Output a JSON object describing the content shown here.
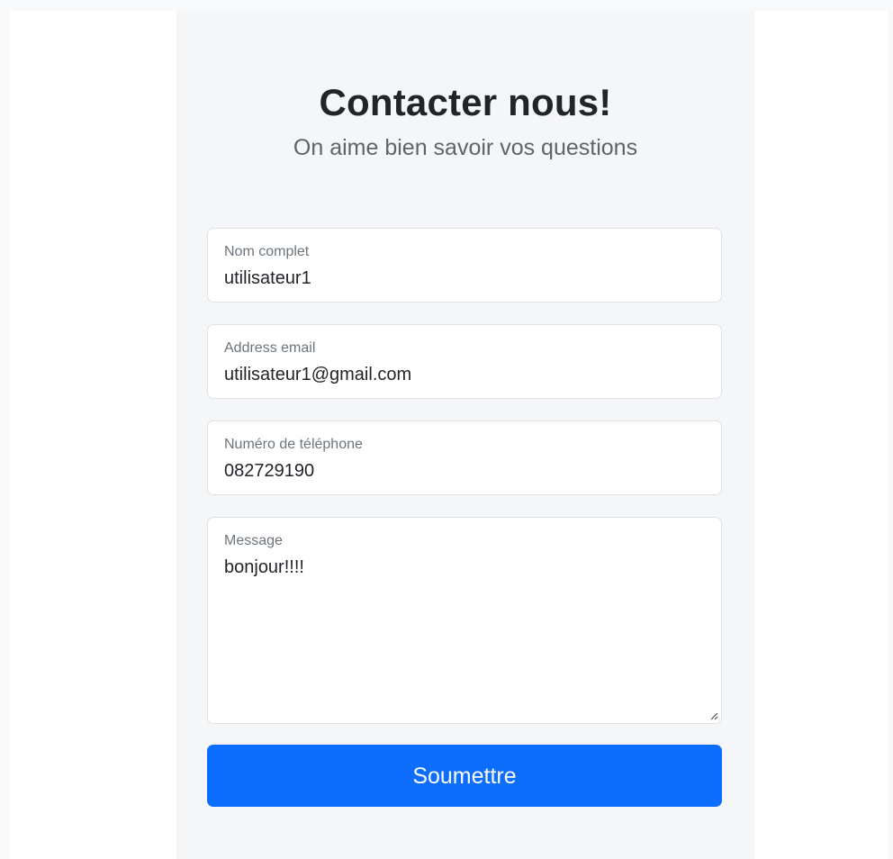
{
  "header": {
    "title": "Contacter nous!",
    "subtitle": "On aime bien savoir vos questions"
  },
  "form": {
    "name": {
      "label": "Nom complet",
      "value": "utilisateur1"
    },
    "email": {
      "label": "Address email",
      "value": "utilisateur1@gmail.com"
    },
    "phone": {
      "label": "Numéro de téléphone",
      "value": "082729190"
    },
    "message": {
      "label": "Message",
      "value": "bonjour!!!!"
    },
    "submit_label": "Soumettre"
  },
  "colors": {
    "accent": "#0d6efd",
    "card_background": "#f5f6f8",
    "text": "#212529",
    "muted": "#6c757d"
  }
}
